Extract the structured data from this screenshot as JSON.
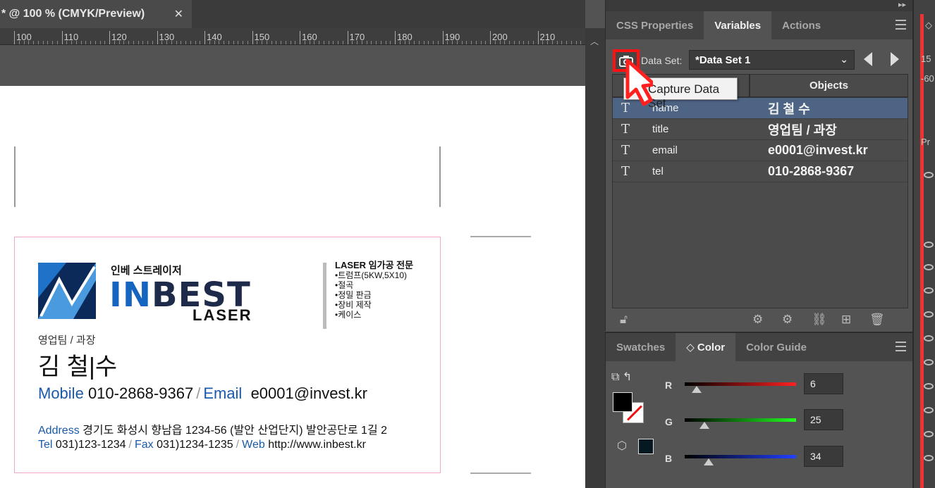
{
  "document": {
    "tab_title": "* @ 100 % (CMYK/Preview)",
    "close_glyph": "✕",
    "ruler_labels": [
      "100",
      "110",
      "120",
      "130",
      "140",
      "150",
      "160",
      "170",
      "180",
      "190",
      "200",
      "210"
    ]
  },
  "card": {
    "company_ko": "인베 스트레이저",
    "brand_in": "IN",
    "brand_rest": "BEST",
    "brand_sub": "LASER",
    "services_head": "LASER 임가공 전문",
    "services": [
      "•트럼프(5KW,5X10)",
      "•절곡",
      "•정밀 판금",
      "•장비 제작",
      "•케이스"
    ],
    "title": "영업팀 / 과장",
    "name": "김 철|수",
    "mobile_label": "Mobile",
    "mobile": "010-2868-9367",
    "email_label": "Email",
    "email": "e0001@invest.kr",
    "address_label": "Address",
    "address": "경기도 화성시 향남읍 1234-56 (발안 산업단지) 발안공단로 1길 2",
    "tel_label": "Tel",
    "tel": "031)123-1234",
    "fax_label": "Fax",
    "fax": "031)1234-1235",
    "web_label": "Web",
    "web": "http://www.inbest.kr",
    "separator": "/"
  },
  "variables_panel": {
    "tabs": [
      {
        "label": "CSS Properties",
        "active": false
      },
      {
        "label": "Variables",
        "active": true
      },
      {
        "label": "Actions",
        "active": false
      }
    ],
    "data_set_label": "Data Set:",
    "data_set_value": "*Data Set 1",
    "tooltip": "Capture Data Set",
    "col_objects": "Objects",
    "variables": [
      {
        "type": "T",
        "name": "name",
        "value": "김 철 수",
        "selected": true
      },
      {
        "type": "T",
        "name": "title",
        "value": "영업팀 / 과장",
        "selected": false
      },
      {
        "type": "T",
        "name": "email",
        "value": "e0001@invest.kr",
        "selected": false
      },
      {
        "type": "T",
        "name": "tel",
        "value": "010-2868-9367",
        "selected": false
      }
    ]
  },
  "color_panel": {
    "tabs": [
      {
        "label": "Swatches",
        "active": false
      },
      {
        "label": "◇ Color",
        "active": true
      },
      {
        "label": "Color Guide",
        "active": false
      }
    ],
    "channels": [
      {
        "label": "R",
        "value": "6",
        "fraction": 0.024,
        "gradient": "linear-gradient(to right,#000,#ff2020)"
      },
      {
        "label": "G",
        "value": "25",
        "fraction": 0.098,
        "gradient": "linear-gradient(to right,#000,#20ff20)"
      },
      {
        "label": "B",
        "value": "34",
        "fraction": 0.133,
        "gradient": "linear-gradient(to right,#000,#2040ff)"
      }
    ],
    "fill_color": "#000000",
    "swatch_color": "#061922"
  },
  "right_strip": {
    "texts": [
      "15",
      "-60",
      "Pr"
    ]
  }
}
